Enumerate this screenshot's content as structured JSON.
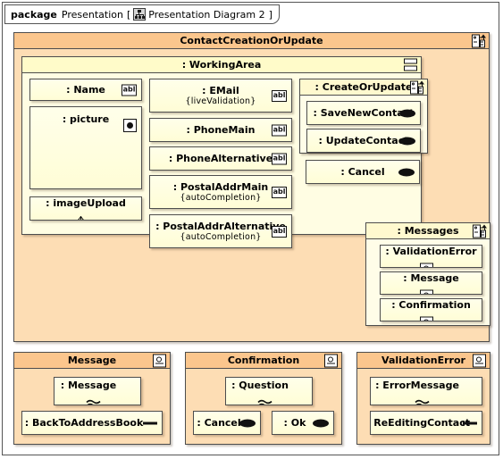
{
  "package": {
    "keyword": "package",
    "name": "Presentation",
    "bracket_open": "[",
    "diagram_icon": "structure-diagram-icon",
    "diagram_name": "Presentation Diagram 2",
    "bracket_close": "]"
  },
  "colors": {
    "container_header": "#FBC68D",
    "container_body": "#FDDDB4",
    "inner_header": "#FFFBC9",
    "inner_body": "#FFFDE3",
    "widget_fill": "#FFFFE0",
    "border": "#4D4D4D",
    "text": "#000000"
  },
  "contact_creation": {
    "title": "ContactCreationOrUpdate",
    "icon": "part-component-icon",
    "working_area": {
      "title": ": WorkingArea",
      "icon": "panel-icon",
      "left_column": [
        {
          "label": ": Name",
          "icon": "abl-textfield-icon",
          "constraint": null
        },
        {
          "label": ": picture",
          "icon": "radio-image-icon",
          "constraint": null
        },
        {
          "label": ": imageUpload",
          "icon": "upload-icon",
          "constraint": null
        }
      ],
      "middle_column": [
        {
          "label": ": EMail",
          "icon": "abl-textfield-icon",
          "constraint": "{liveValidation}"
        },
        {
          "label": ": PhoneMain",
          "icon": "abl-textfield-icon",
          "constraint": null
        },
        {
          "label": ": PhoneAlternative",
          "icon": "abl-textfield-icon",
          "constraint": null
        },
        {
          "label": ": PostalAddrMain",
          "icon": "abl-textfield-icon",
          "constraint": "{autoCompletion}"
        },
        {
          "label": ": PostalAddrAlternative",
          "icon": "abl-textfield-icon",
          "constraint": "{autoCompletion}"
        }
      ],
      "create_or_update": {
        "title": ": CreateOrUpdate",
        "icon": "part-component-icon",
        "buttons": [
          {
            "label": ": SaveNewContact",
            "icon": "button-icon"
          },
          {
            "label": ": UpdateContact",
            "icon": "button-icon"
          }
        ]
      },
      "cancel_button": {
        "label": ": Cancel",
        "icon": "button-icon"
      }
    },
    "messages": {
      "title": ": Messages",
      "icon": "part-component-icon",
      "items": [
        {
          "label": ": ValidationError",
          "icon": "combo-icon"
        },
        {
          "label": ": Message",
          "icon": "combo-icon"
        },
        {
          "label": ": Confirmation",
          "icon": "combo-icon"
        }
      ]
    }
  },
  "bottom_panels": [
    {
      "title": "Message",
      "icon": "combo-icon",
      "items": [
        {
          "label": ": Message",
          "icon": "wave-text-icon",
          "row": 0,
          "col": 0,
          "wide": false
        },
        {
          "label": ": BackToAddressBook",
          "icon": "line-button-icon",
          "row": 1,
          "col": 0,
          "wide": true
        }
      ]
    },
    {
      "title": "Confirmation",
      "icon": "combo-icon",
      "items": [
        {
          "label": ": Question",
          "icon": "wave-text-icon",
          "row": 0,
          "col": 0,
          "wide": false
        },
        {
          "label": ": Cancel",
          "icon": "button-icon",
          "row": 1,
          "col": 0,
          "wide": false
        },
        {
          "label": ": Ok",
          "icon": "button-icon",
          "row": 1,
          "col": 1,
          "wide": false
        }
      ]
    },
    {
      "title": "ValidationError",
      "icon": "combo-icon",
      "items": [
        {
          "label": ": ErrorMessage",
          "icon": "wave-text-icon",
          "row": 0,
          "col": 0,
          "wide": true
        },
        {
          "label": ": ReEditingContact",
          "icon": "line-button-icon",
          "row": 1,
          "col": 0,
          "wide": true
        }
      ]
    }
  ]
}
